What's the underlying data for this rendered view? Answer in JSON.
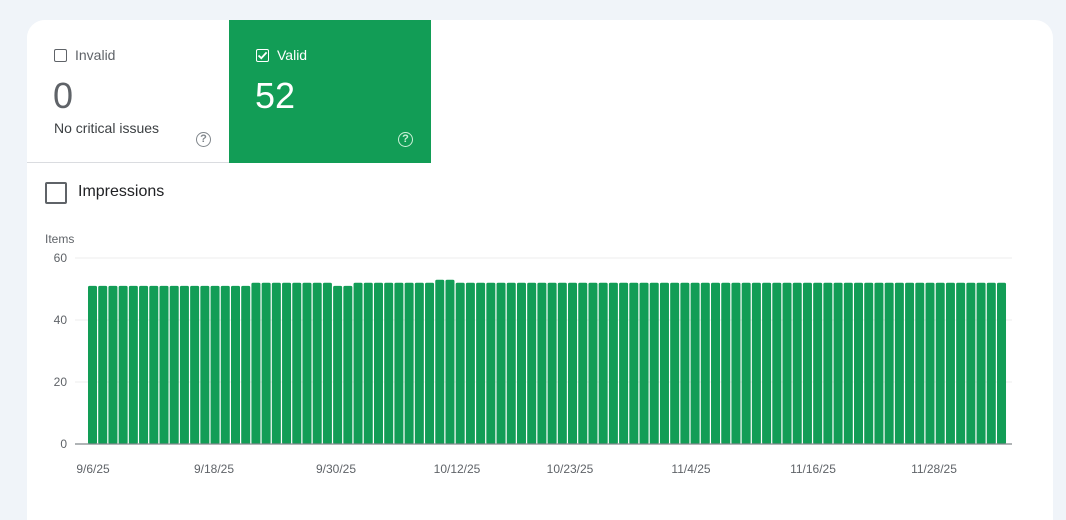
{
  "tiles": {
    "invalid": {
      "label": "Invalid",
      "value": "0",
      "subtitle": "No critical issues",
      "checked": false
    },
    "valid": {
      "label": "Valid",
      "value": "52",
      "checked": true
    }
  },
  "help_icon_glyph": "?",
  "metric_toggle": {
    "label": "Impressions",
    "checked": false
  },
  "colors": {
    "valid_green": "#129d56",
    "bar_green": "#129d56",
    "page_background": "#f0f4f9"
  },
  "chart_data": {
    "type": "bar",
    "ylabel": "Items",
    "ylim": [
      0,
      60
    ],
    "yticks": [
      "0",
      "20",
      "40",
      "60"
    ],
    "grid": true,
    "xtick_labels": [
      "9/6/25",
      "9/18/25",
      "9/30/25",
      "10/12/25",
      "10/23/25",
      "11/4/25",
      "11/16/25",
      "11/28/25"
    ],
    "values": [
      51,
      51,
      51,
      51,
      51,
      51,
      51,
      51,
      51,
      51,
      51,
      51,
      51,
      51,
      51,
      51,
      52,
      52,
      52,
      52,
      52,
      52,
      52,
      52,
      51,
      51,
      52,
      52,
      52,
      52,
      52,
      52,
      52,
      52,
      53,
      53,
      52,
      52,
      52,
      52,
      52,
      52,
      52,
      52,
      52,
      52,
      52,
      52,
      52,
      52,
      52,
      52,
      52,
      52,
      52,
      52,
      52,
      52,
      52,
      52,
      52,
      52,
      52,
      52,
      52,
      52,
      52,
      52,
      52,
      52,
      52,
      52,
      52,
      52,
      52,
      52,
      52,
      52,
      52,
      52,
      52,
      52,
      52,
      52,
      52,
      52,
      52,
      52,
      52,
      52
    ]
  }
}
